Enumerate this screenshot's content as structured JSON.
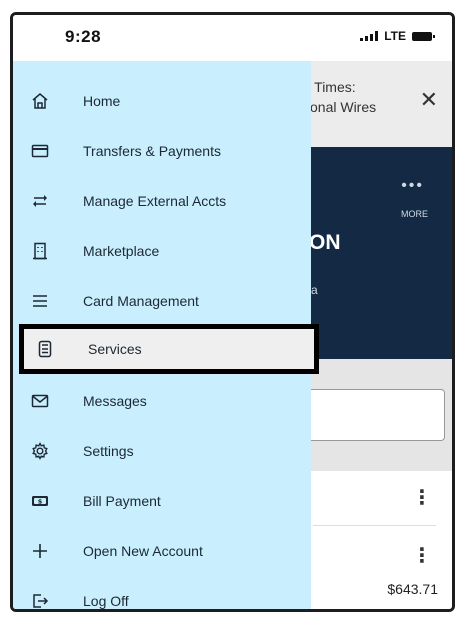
{
  "status_bar": {
    "time": "9:28",
    "network": "LTE"
  },
  "background": {
    "banner_line1": "ff Times:",
    "banner_line2": "tional Wires",
    "more_label": "MORE",
    "hero_title": "ON",
    "hero_subtitle": "a",
    "amount": "$643.71"
  },
  "menu": {
    "items": [
      {
        "label": "Home",
        "icon": "home-icon"
      },
      {
        "label": "Transfers & Payments",
        "icon": "credit-card-icon"
      },
      {
        "label": "Manage External Accts",
        "icon": "transfer-arrows-icon"
      },
      {
        "label": "Marketplace",
        "icon": "building-icon"
      },
      {
        "label": "Card Management",
        "icon": "hamburger-lines-icon"
      },
      {
        "label": "Services",
        "icon": "calculator-icon",
        "selected": true
      },
      {
        "label": "Messages",
        "icon": "envelope-icon"
      },
      {
        "label": "Settings",
        "icon": "gear-icon"
      },
      {
        "label": "Bill Payment",
        "icon": "dollar-bill-icon"
      },
      {
        "label": "Open New Account",
        "icon": "plus-icon"
      },
      {
        "label": "Log Off",
        "icon": "logout-icon"
      }
    ]
  },
  "colors": {
    "drawer_bg": "#c9efff",
    "hero_bg": "#142a44",
    "selected_outline": "#000000"
  }
}
